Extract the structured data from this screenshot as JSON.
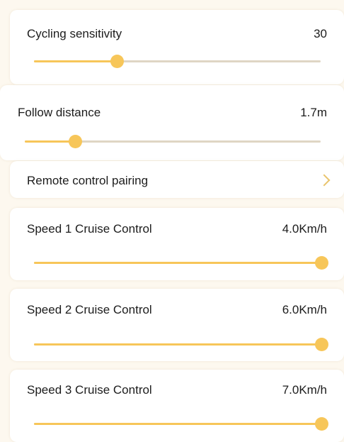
{
  "colors": {
    "accent": "#f7c659",
    "track": "#dfd6c4",
    "chevron": "#e9c46d",
    "page_bg": "#fdf8ef"
  },
  "cycling_sensitivity": {
    "label": "Cycling sensitivity",
    "value": "30",
    "slider_fraction": 0.29
  },
  "follow_distance": {
    "label": "Follow distance",
    "value": "1.7m",
    "slider_fraction": 0.17
  },
  "remote_pairing": {
    "label": "Remote control pairing",
    "chevron_icon": "chevron-right-icon"
  },
  "speed1": {
    "label": "Speed 1 Cruise Control",
    "value": "4.0Km/h",
    "slider_fraction": 1.0
  },
  "speed2": {
    "label": "Speed 2 Cruise Control",
    "value": "6.0Km/h",
    "slider_fraction": 1.0
  },
  "speed3": {
    "label": "Speed 3 Cruise Control",
    "value": "7.0Km/h",
    "slider_fraction": 1.0
  }
}
